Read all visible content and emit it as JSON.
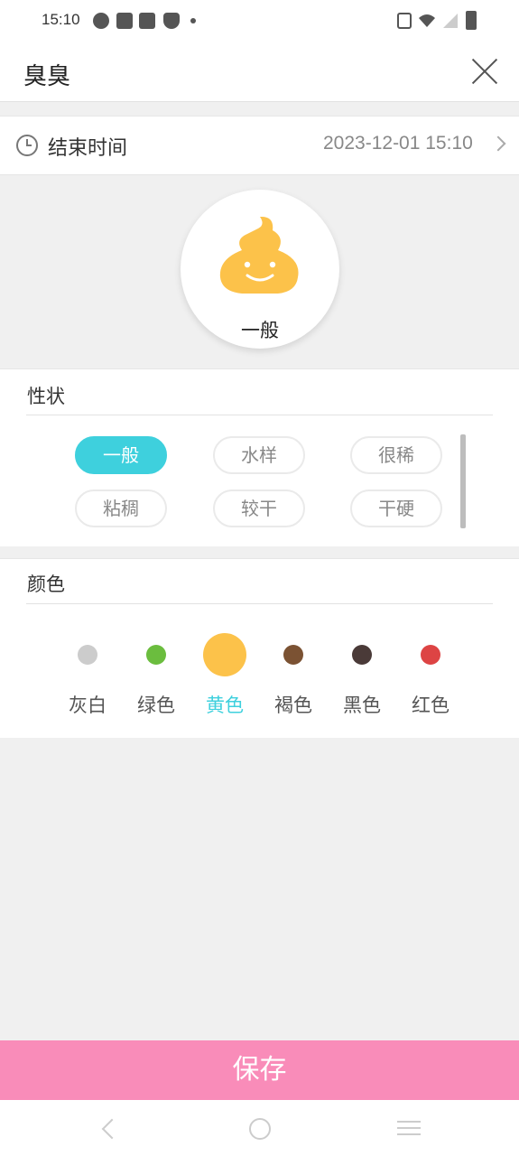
{
  "status_bar": {
    "time": "15:10"
  },
  "header": {
    "title": "臭臭"
  },
  "end_time": {
    "label": "结束时间",
    "value": "2023-12-01 15:10"
  },
  "preview": {
    "label": "一般"
  },
  "shape": {
    "title": "性状",
    "options": [
      "一般",
      "水样",
      "很稀",
      "粘稠",
      "较干",
      "干硬"
    ],
    "selected": "一般"
  },
  "color": {
    "title": "颜色",
    "options": [
      {
        "label": "灰白",
        "hex": "#cccccc"
      },
      {
        "label": "绿色",
        "hex": "#6bbd3e"
      },
      {
        "label": "黄色",
        "hex": "#fcc24a"
      },
      {
        "label": "褐色",
        "hex": "#7b5233"
      },
      {
        "label": "黑色",
        "hex": "#4a3a38"
      },
      {
        "label": "红色",
        "hex": "#dd4444"
      }
    ],
    "selected": "黄色"
  },
  "save_label": "保存",
  "colors": {
    "accent": "#3ed0dd",
    "save_bg": "#f98cb9",
    "poop": "#fcc24a"
  }
}
